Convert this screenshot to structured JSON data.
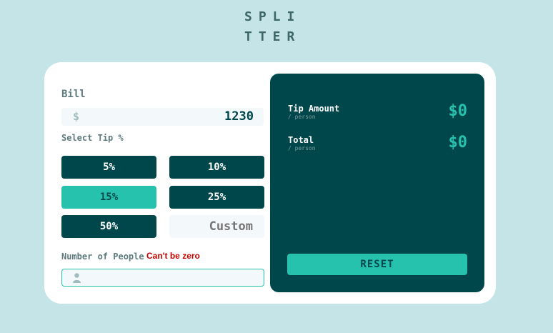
{
  "logo": {
    "line1": "SPLI",
    "line2": "TTER"
  },
  "bill": {
    "label": "Bill",
    "currency_symbol": "$",
    "value": "1230"
  },
  "tip": {
    "label": "Select Tip %",
    "options": [
      "5%",
      "10%",
      "15%",
      "25%",
      "50%"
    ],
    "selected": "15%",
    "custom_placeholder": "Custom"
  },
  "people": {
    "label": "Number of People",
    "error": "Can't be zero",
    "value": "",
    "icon": "person-icon"
  },
  "results": {
    "tip_amount_label": "Tip Amount",
    "tip_amount_sub": "/ person",
    "tip_amount_value": "$0",
    "total_label": "Total",
    "total_sub": "/ person",
    "total_value": "$0",
    "reset_label": "RESET"
  },
  "colors": {
    "background": "#c5e4e7",
    "dark_cyan": "#00474b",
    "strong_cyan": "#26c2ae",
    "error_red": "#c80000"
  }
}
